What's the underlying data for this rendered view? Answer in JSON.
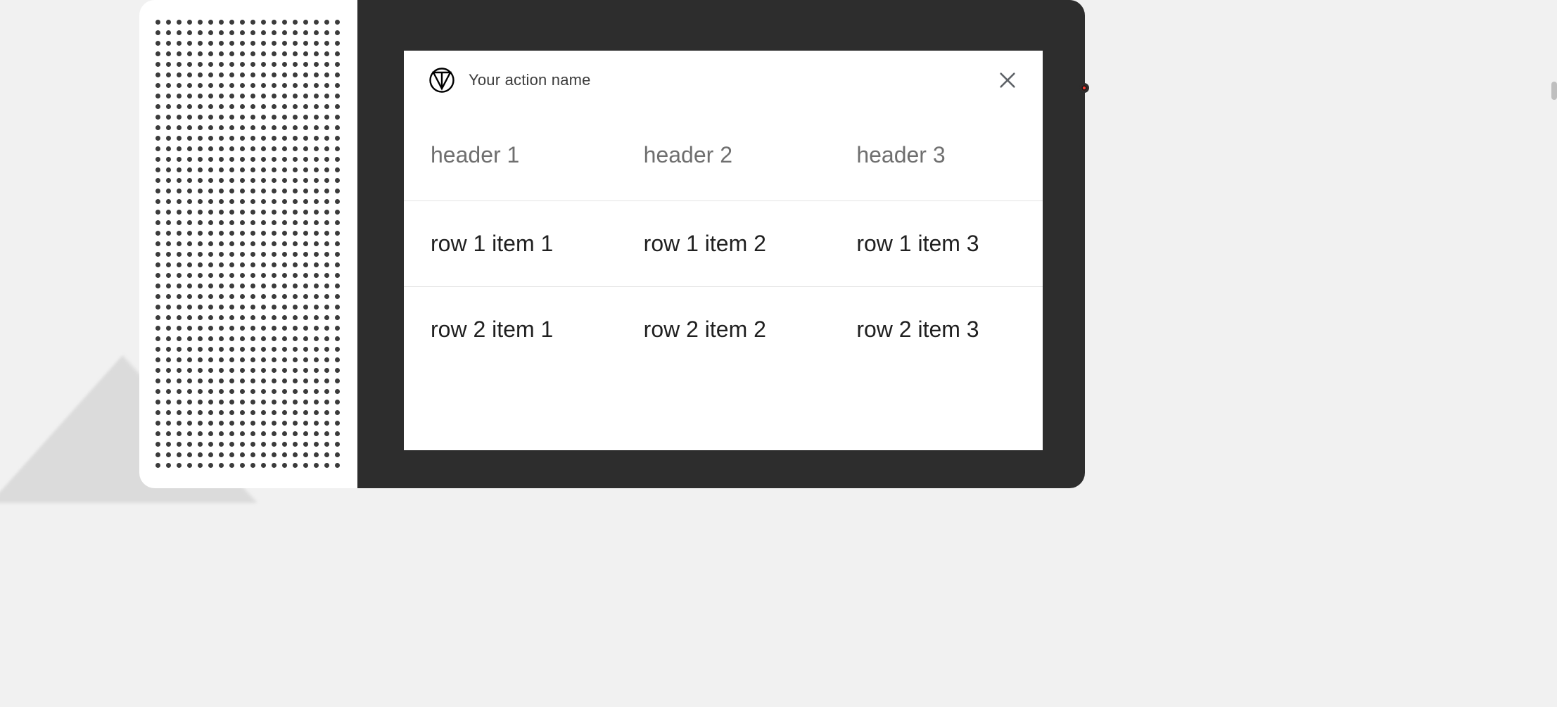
{
  "card": {
    "title": "Your action name",
    "table": {
      "headers": [
        "header 1",
        "header 2",
        "header 3"
      ],
      "rows": [
        [
          "row 1 item 1",
          "row 1 item 2",
          "row 1 item 3"
        ],
        [
          "row 2 item 1",
          "row 2 item 2",
          "row 2 item 3"
        ]
      ]
    }
  }
}
